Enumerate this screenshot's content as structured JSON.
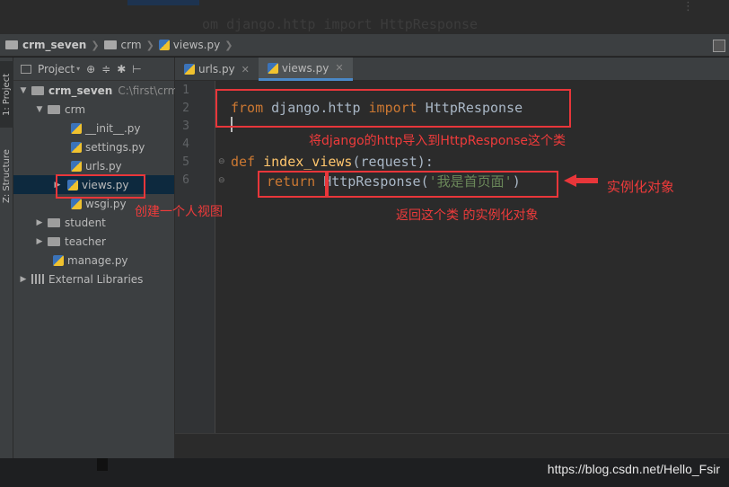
{
  "background": {
    "ghost_code": "om django.http import HttpResponse"
  },
  "breadcrumb": {
    "items": [
      "crm_seven",
      "crm",
      "views.py"
    ]
  },
  "toolstrip": {
    "project_tab": "1: Project",
    "structure_tab": "Z: Structure"
  },
  "project_panel": {
    "toolbar_label": "Project",
    "tree": [
      {
        "label": "crm_seven",
        "path": "C:\\first\\crm_",
        "type": "folder",
        "depth": 0,
        "expanded": true
      },
      {
        "label": "crm",
        "type": "folder",
        "depth": 1,
        "expanded": true
      },
      {
        "label": "__init__.py",
        "type": "py",
        "depth": 2
      },
      {
        "label": "settings.py",
        "type": "py",
        "depth": 2
      },
      {
        "label": "urls.py",
        "type": "py",
        "depth": 2
      },
      {
        "label": "views.py",
        "type": "py",
        "depth": 2,
        "selected": true
      },
      {
        "label": "wsgi.py",
        "type": "py",
        "depth": 2
      },
      {
        "label": "student",
        "type": "folder",
        "depth": 1,
        "expanded": false
      },
      {
        "label": "teacher",
        "type": "folder",
        "depth": 1,
        "expanded": false
      },
      {
        "label": "manage.py",
        "type": "py",
        "depth": 1
      },
      {
        "label": "External Libraries",
        "type": "libs",
        "depth": 0,
        "expanded": false
      }
    ]
  },
  "editor": {
    "tabs": [
      {
        "label": "urls.py",
        "active": false
      },
      {
        "label": "views.py",
        "active": true
      }
    ],
    "line_numbers": [
      "1",
      "2",
      "3",
      "4",
      "5",
      "6"
    ],
    "code": {
      "line2": {
        "kw1": "from",
        "mod": " django.http ",
        "kw2": "import",
        "name": " HttpResponse"
      },
      "line5": {
        "kw": "def",
        "name": " index_views",
        "rest": "(request):"
      },
      "line6": {
        "kw": "return",
        "call": " HttpResponse(",
        "str": "'我是首页面'",
        "close": ")"
      }
    }
  },
  "annotations": {
    "import_note": "将django的http导入到HttpResponse这个类",
    "view_note": "创建一个人视图",
    "return_note": "返回这个类 的实例化对象",
    "instance_note": "实例化对象",
    "color": "#e8363a"
  },
  "watermark": "https://blog.csdn.net/Hello_Fsir"
}
